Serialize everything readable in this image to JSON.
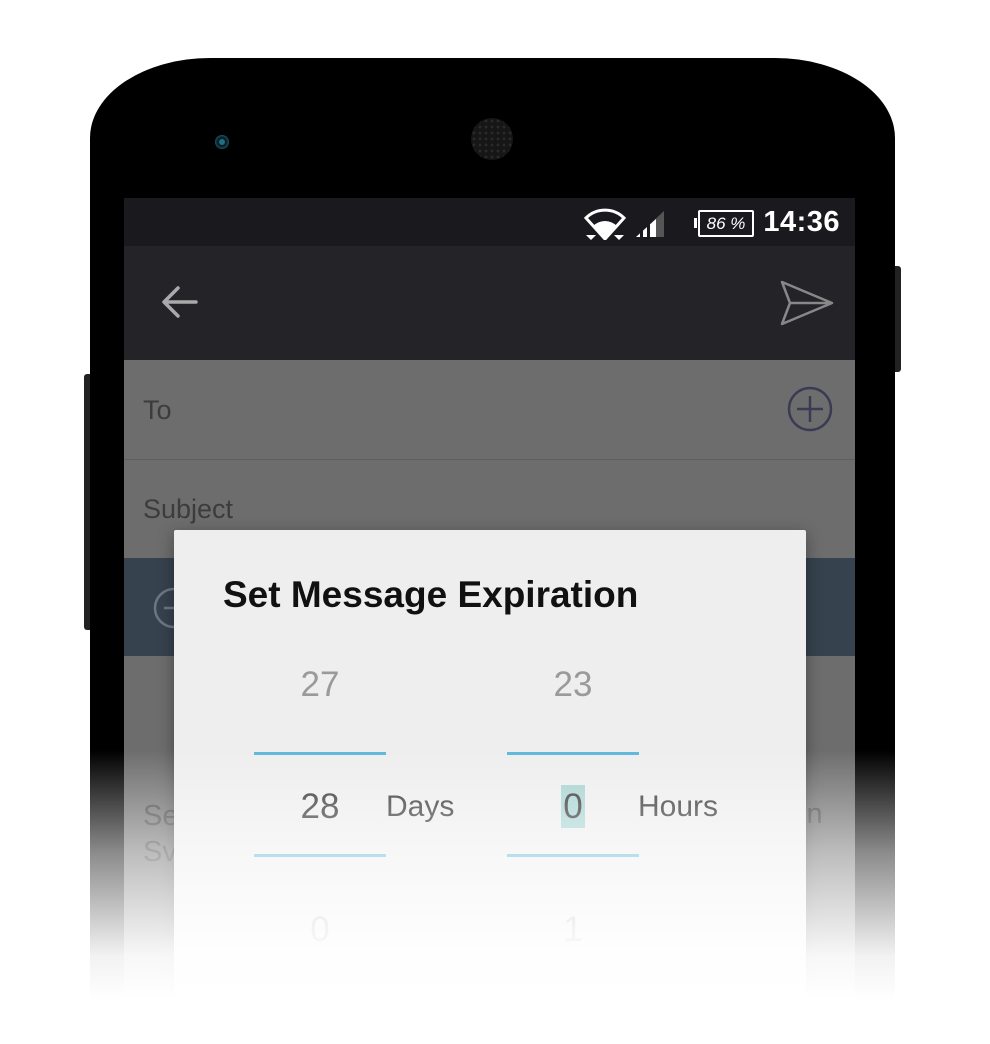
{
  "status_bar": {
    "battery": "86 %",
    "time": "14:36",
    "icons": [
      "wifi-icon",
      "cell-signal-icon",
      "battery-icon"
    ]
  },
  "app_bar": {
    "icons": [
      "back-arrow-icon",
      "send-icon"
    ]
  },
  "compose": {
    "to_label": "To",
    "subject_label": "Subject",
    "body_left": "Se\nSv",
    "body_right": "in"
  },
  "dialog": {
    "title": "Set Message Expiration",
    "days": {
      "prev": "27",
      "current": "28",
      "next": "0",
      "unit": "Days"
    },
    "hours": {
      "prev": "23",
      "current": "0",
      "next": "1",
      "unit": "Hours"
    }
  },
  "colors": {
    "accent_line": "#5fb7dc",
    "selection_highlight": "#a7d3d2",
    "appbar": "#232328",
    "banner": "#36424e"
  }
}
